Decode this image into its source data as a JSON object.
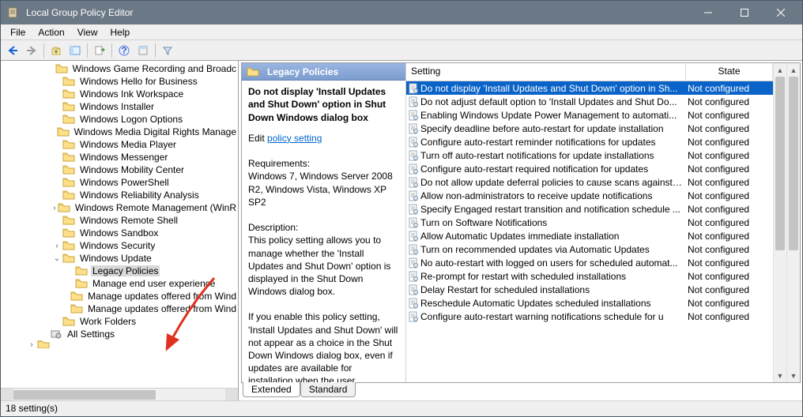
{
  "window": {
    "title": "Local Group Policy Editor"
  },
  "menu": {
    "items": [
      "File",
      "Action",
      "View",
      "Help"
    ]
  },
  "tree": {
    "items": [
      {
        "indent": 4,
        "label": "Windows Game Recording and Broadc",
        "tw": ""
      },
      {
        "indent": 4,
        "label": "Windows Hello for Business",
        "tw": ""
      },
      {
        "indent": 4,
        "label": "Windows Ink Workspace",
        "tw": ""
      },
      {
        "indent": 4,
        "label": "Windows Installer",
        "tw": ""
      },
      {
        "indent": 4,
        "label": "Windows Logon Options",
        "tw": ""
      },
      {
        "indent": 4,
        "label": "Windows Media Digital Rights Manage",
        "tw": ""
      },
      {
        "indent": 4,
        "label": "Windows Media Player",
        "tw": ""
      },
      {
        "indent": 4,
        "label": "Windows Messenger",
        "tw": ""
      },
      {
        "indent": 4,
        "label": "Windows Mobility Center",
        "tw": ""
      },
      {
        "indent": 4,
        "label": "Windows PowerShell",
        "tw": ""
      },
      {
        "indent": 4,
        "label": "Windows Reliability Analysis",
        "tw": ""
      },
      {
        "indent": 4,
        "label": "Windows Remote Management (WinR",
        "tw": ">"
      },
      {
        "indent": 4,
        "label": "Windows Remote Shell",
        "tw": ""
      },
      {
        "indent": 4,
        "label": "Windows Sandbox",
        "tw": ""
      },
      {
        "indent": 4,
        "label": "Windows Security",
        "tw": ">"
      },
      {
        "indent": 4,
        "label": "Windows Update",
        "tw": "v"
      },
      {
        "indent": 5,
        "label": "Legacy Policies",
        "tw": "",
        "sel": true
      },
      {
        "indent": 5,
        "label": "Manage end user experience",
        "tw": ""
      },
      {
        "indent": 5,
        "label": "Manage updates offered from Wind",
        "tw": ""
      },
      {
        "indent": 5,
        "label": "Manage updates offered from Wind",
        "tw": ""
      },
      {
        "indent": 4,
        "label": "Work Folders",
        "tw": ""
      },
      {
        "indent": 3,
        "label": "All Settings",
        "tw": "",
        "icon": "settings"
      },
      {
        "indent": 2,
        "label": "",
        "tw": ">",
        "cut": true
      }
    ]
  },
  "detail": {
    "header": "Legacy Policies",
    "title": "Do not display 'Install Updates and Shut Down' option in Shut Down Windows dialog box",
    "edit_prefix": "Edit ",
    "policy_link": "policy setting",
    "req_label": "Requirements:",
    "req_text": "Windows 7, Windows Server 2008 R2, Windows Vista, Windows XP SP2",
    "desc_label": "Description:",
    "desc_text1": "This policy setting allows you to manage whether the 'Install Updates and Shut Down' option is displayed in the Shut Down Windows dialog box.",
    "desc_text2": "If you enable this policy setting, 'Install Updates and Shut Down' will not appear as a choice in the Shut Down Windows dialog box, even if updates are available for installation when the user"
  },
  "list": {
    "cols": {
      "setting": "Setting",
      "state": "State"
    },
    "rows": [
      {
        "s": "Do not display 'Install Updates and Shut Down' option in Sh...",
        "st": "Not configured",
        "sel": true
      },
      {
        "s": "Do not adjust default option to 'Install Updates and Shut Do...",
        "st": "Not configured"
      },
      {
        "s": "Enabling Windows Update Power Management to automati...",
        "st": "Not configured"
      },
      {
        "s": "Specify deadline before auto-restart for update installation",
        "st": "Not configured"
      },
      {
        "s": "Configure auto-restart reminder notifications for updates",
        "st": "Not configured"
      },
      {
        "s": "Turn off auto-restart notifications for update installations",
        "st": "Not configured"
      },
      {
        "s": "Configure auto-restart required notification for updates",
        "st": "Not configured"
      },
      {
        "s": "Do not allow update deferral policies to cause scans against ...",
        "st": "Not configured"
      },
      {
        "s": "Allow non-administrators to receive update notifications",
        "st": "Not configured"
      },
      {
        "s": "Specify Engaged restart transition and notification schedule ...",
        "st": "Not configured"
      },
      {
        "s": "Turn on Software Notifications",
        "st": "Not configured"
      },
      {
        "s": "Allow Automatic Updates immediate installation",
        "st": "Not configured"
      },
      {
        "s": "Turn on recommended updates via Automatic Updates",
        "st": "Not configured"
      },
      {
        "s": "No auto-restart with logged on users for scheduled automat...",
        "st": "Not configured"
      },
      {
        "s": "Re-prompt for restart with scheduled installations",
        "st": "Not configured"
      },
      {
        "s": "Delay Restart for scheduled installations",
        "st": "Not configured"
      },
      {
        "s": "Reschedule Automatic Updates scheduled installations",
        "st": "Not configured"
      },
      {
        "s": "Configure auto-restart warning notifications schedule for u",
        "st": "Not configured"
      }
    ]
  },
  "tabs": {
    "extended": "Extended",
    "standard": "Standard"
  },
  "status": {
    "text": "18 setting(s)"
  }
}
